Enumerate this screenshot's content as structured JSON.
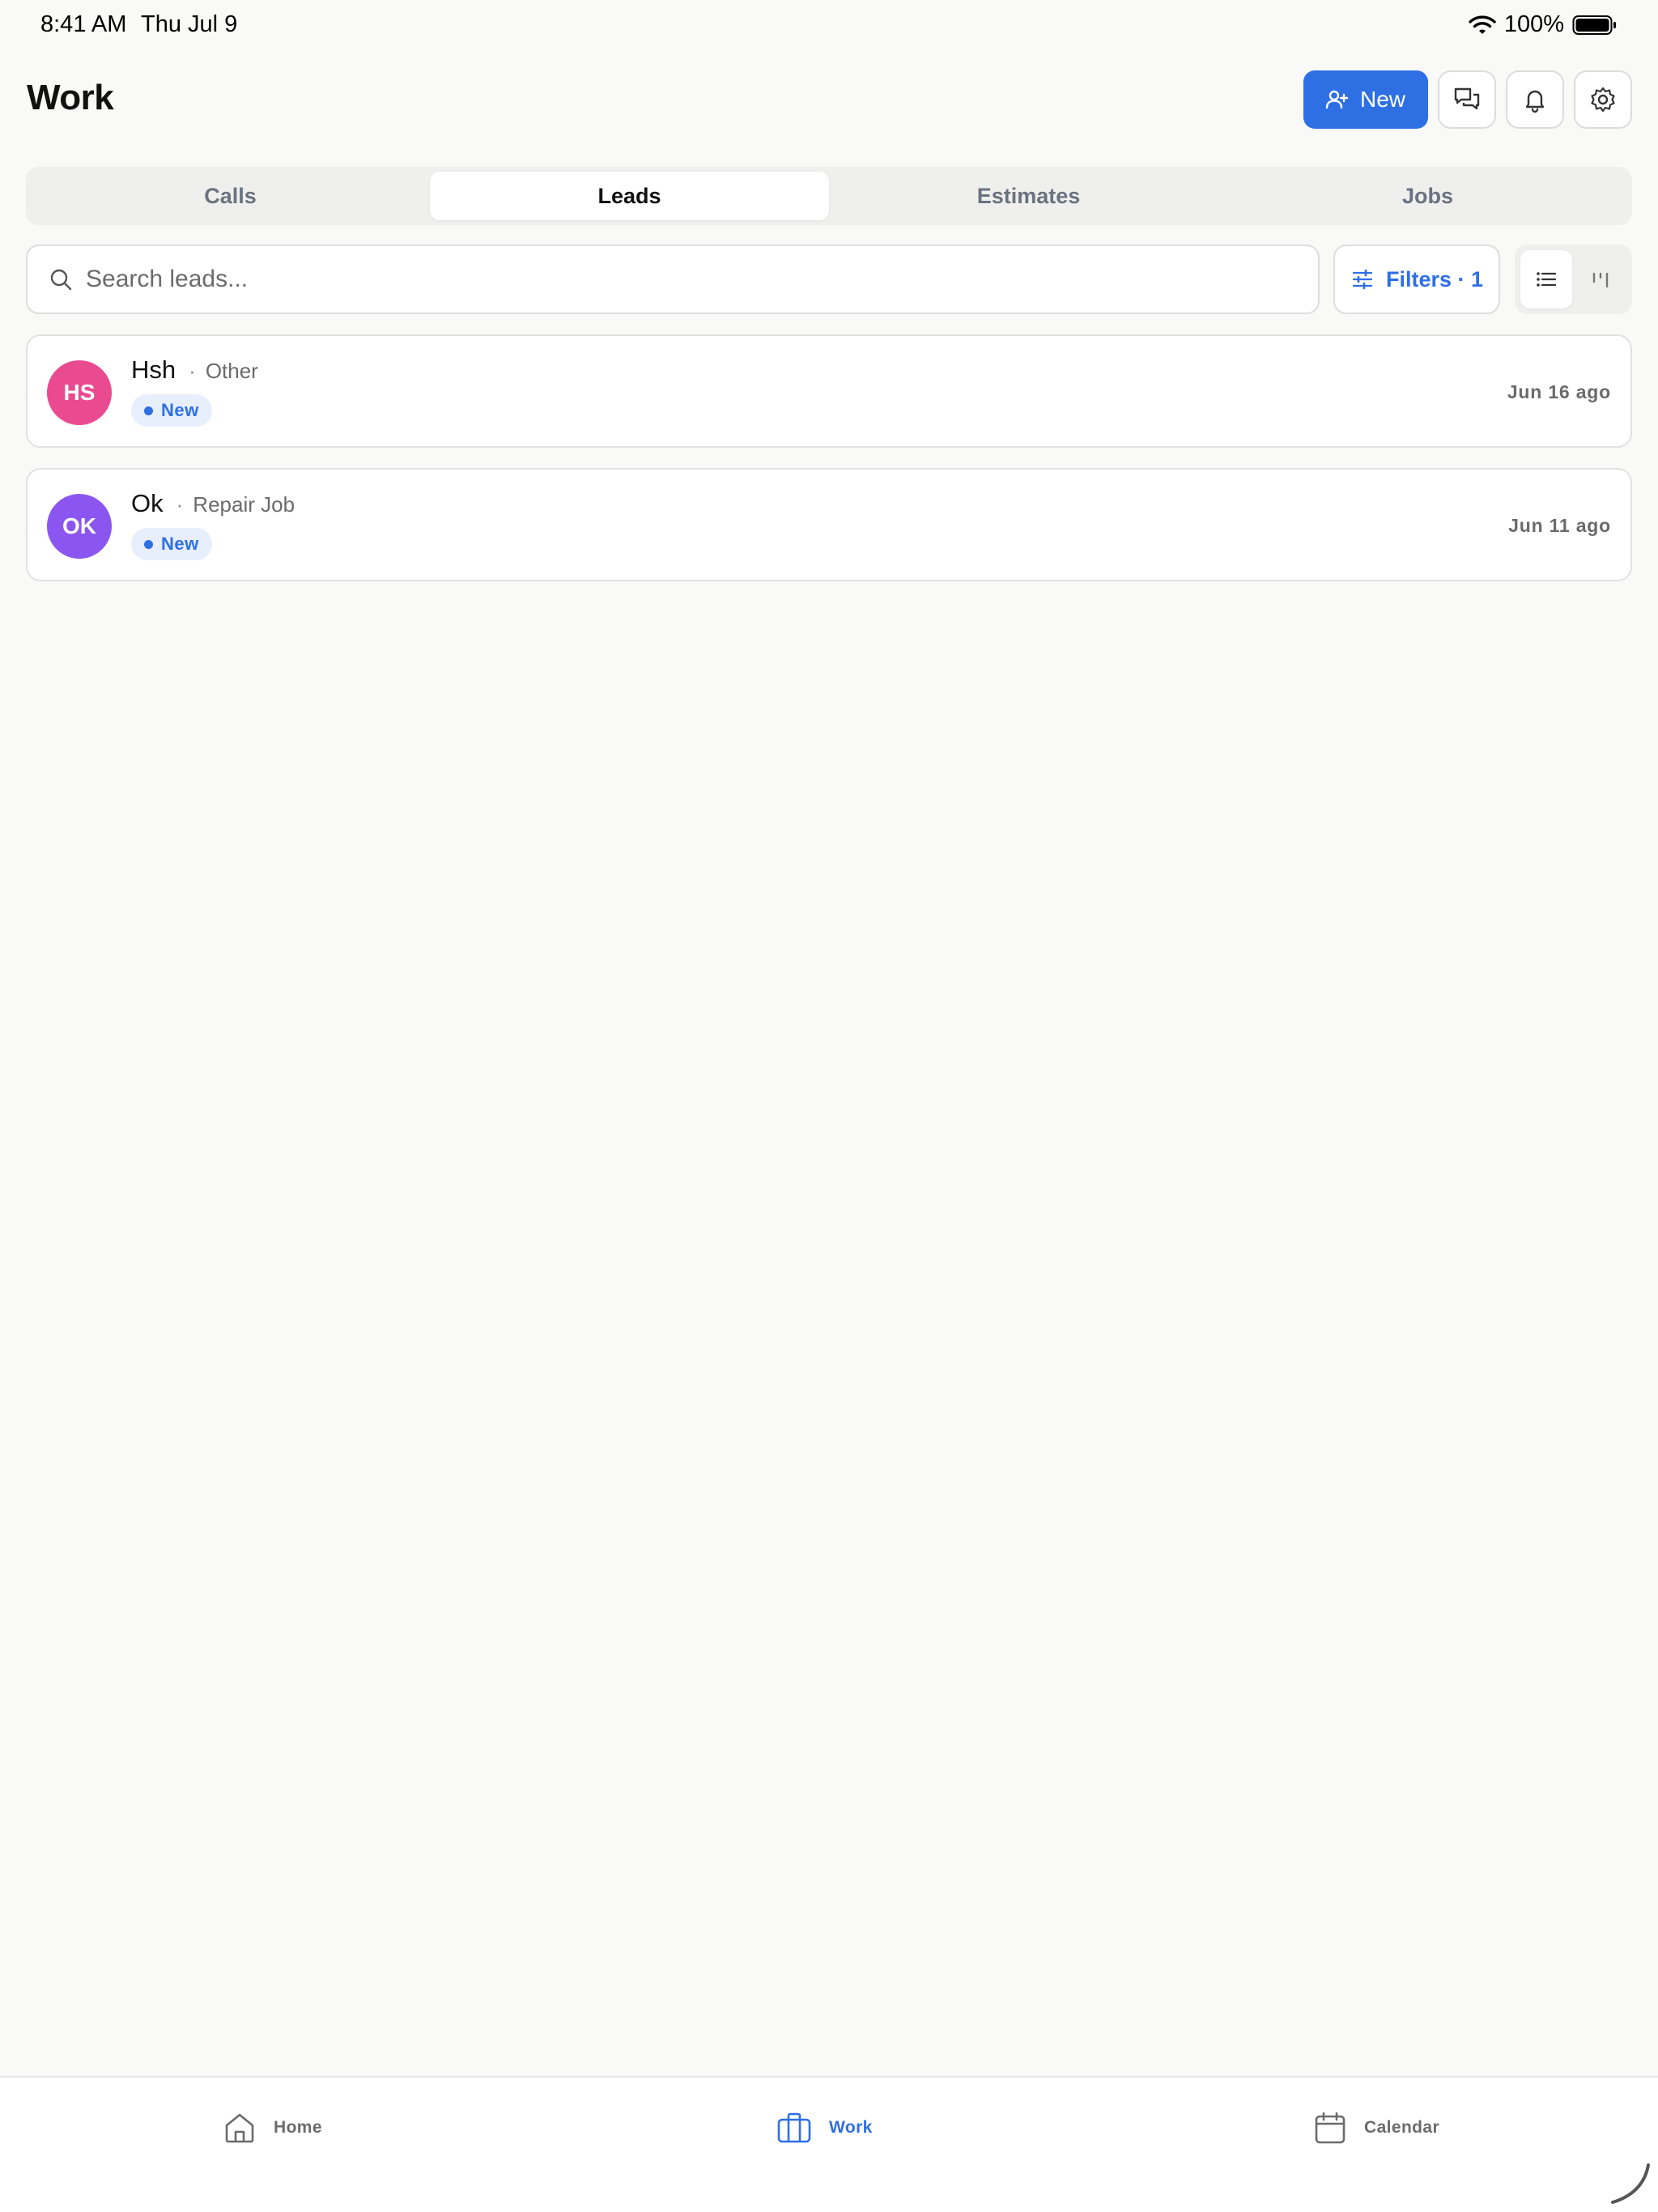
{
  "status_bar": {
    "time": "8:41 AM",
    "date": "Thu Jul 9",
    "battery": "100%"
  },
  "header": {
    "title": "Work",
    "new_label": "New"
  },
  "tabs": [
    {
      "label": "Calls",
      "active": false
    },
    {
      "label": "Leads",
      "active": true
    },
    {
      "label": "Estimates",
      "active": false
    },
    {
      "label": "Jobs",
      "active": false
    }
  ],
  "search": {
    "placeholder": "Search leads...",
    "value": ""
  },
  "filters": {
    "label": "Filters · 1"
  },
  "view_toggle": {
    "selected": "list"
  },
  "leads": [
    {
      "initials": "HS",
      "name": "Hsh",
      "separator": "·",
      "type": "Other",
      "status": "New",
      "date": "Jun 16 ago",
      "avatar_color": "#ea4a8f"
    },
    {
      "initials": "OK",
      "name": "Ok",
      "separator": "·",
      "type": "Repair Job",
      "status": "New",
      "date": "Jun 11 ago",
      "avatar_color": "#8b56f0"
    }
  ],
  "bottom_nav": [
    {
      "label": "Home",
      "icon": "home-icon",
      "active": false
    },
    {
      "label": "Work",
      "icon": "briefcase-icon",
      "active": true
    },
    {
      "label": "Calendar",
      "icon": "calendar-icon",
      "active": false
    }
  ],
  "colors": {
    "accent": "#2f6fe4",
    "background": "#f9f9f8"
  }
}
